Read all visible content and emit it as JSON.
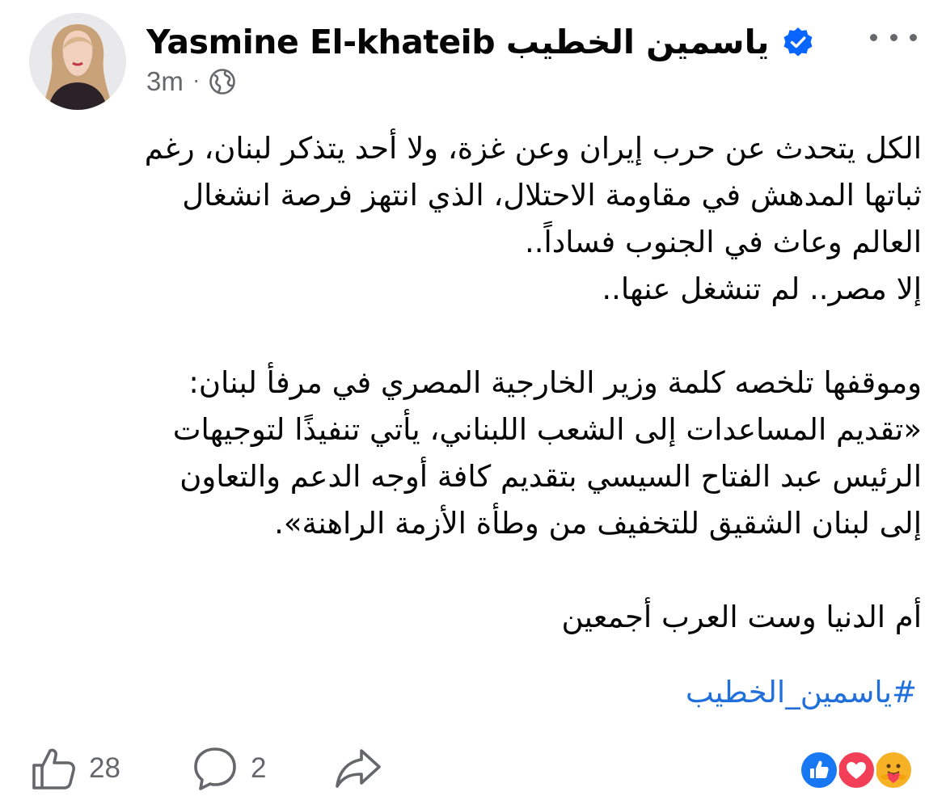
{
  "author": {
    "name": "Yasmine El-khateib ياسمين  الخطيب",
    "verified": true,
    "avatar_icon": "profile-photo"
  },
  "meta": {
    "time": "3m",
    "separator": "·",
    "privacy_icon": "globe-icon"
  },
  "more_icon": "more-horizontal-icon",
  "post": {
    "lines": [
      "الكل يتحدث عن حرب إيران وعن غزة، ولا أحد يتذكر لبنان، رغم",
      "ثباتها المدهش في مقاومة الاحتلال، الذي انتهز فرصة انشغال",
      "العالم وعاث في الجنوب فساداً..",
      "إلا مصر.. لم تنشغل عنها..",
      "",
      "وموقفها تلخصه كلمة وزير الخارجية المصري في مرفأ لبنان:",
      "«تقديم المساعدات إلى الشعب اللبناني، يأتي تنفيذًا لتوجيهات",
      "الرئيس عبد الفتاح السيسي بتقديم كافة أوجه الدعم والتعاون",
      "إلى لبنان الشقيق للتخفيف من وطأة الأزمة الراهنة».",
      "",
      "أم الدنيا وست العرب أجمعين"
    ],
    "hashtag": "#ياسمين_الخطيب"
  },
  "actions": {
    "like_count": "28",
    "comment_count": "2",
    "like_icon": "thumbs-up-icon",
    "comment_icon": "comment-icon",
    "share_icon": "share-icon"
  },
  "reactions": [
    "like",
    "love",
    "care"
  ],
  "colors": {
    "verified": "#0866ff",
    "hashtag": "#216fdb",
    "secondary_text": "#65676b",
    "like": "#1877f2",
    "love": "#f33e58",
    "care": "#f7b125"
  }
}
